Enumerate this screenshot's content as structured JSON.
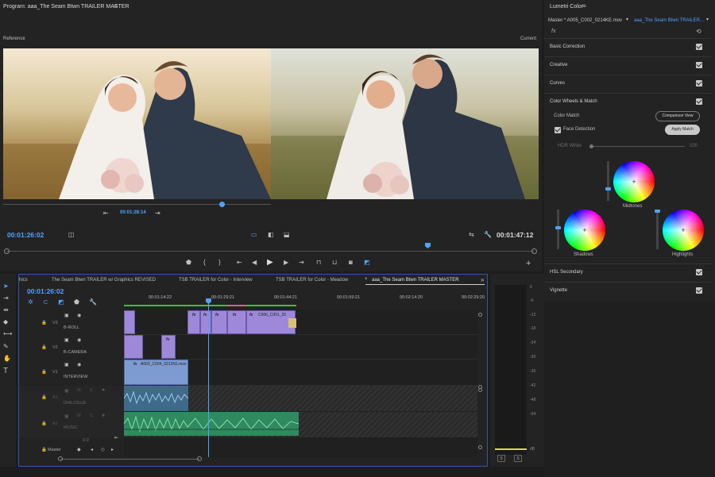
{
  "program": {
    "title": "Program: aaa_The Seam  Btwn TRAILER MASTER",
    "reference_label": "Reference",
    "current_label": "Current",
    "ref_timecode": "00:01:28:14",
    "left_timecode": "00:01:26:02",
    "right_timecode": "00:01:47:12"
  },
  "lumetri": {
    "title": "Lumetri Color",
    "master_label": "Master * A005_C002_0214KE.mov",
    "sequence_label": "aaa_The Seam  Btwn TRAILER...",
    "fx_label": "fx",
    "sections": {
      "basic": "Basic Correction",
      "creative": "Creative",
      "curves": "Curves",
      "wheels": "Color Wheels & Match",
      "hsl": "HSL Secondary",
      "vignette": "Vignette"
    },
    "color_match_label": "Color Match",
    "comparison_view": "Comparison View",
    "face_detection": "Face Detection",
    "apply_match": "Apply Match",
    "hdr_white_label": "HDR White",
    "hdr_white_value": "100",
    "hdr_white_fraction": 0.0,
    "wheels": {
      "midtones": "Midtones",
      "shadows": "Shadows",
      "highlights": "Highlights"
    }
  },
  "timeline": {
    "tabs": [
      "hics",
      "The Seam Btwn TRAILER w/ Graphics REVISED",
      "TSB TRAILER for Color - Interview",
      "TSB TRAILER for Color - Meadow",
      "aaa_The Seam  Btwn TRAILER MASTER"
    ],
    "timecode": "00:01:26:02",
    "ruler": [
      "00:01:14:22",
      "00:01:29:21",
      "00:01:44:21",
      "00:01:59:21",
      "00:02:14:20",
      "00:02:29:20"
    ],
    "tracks": [
      {
        "id": "V3",
        "name": "B-ROLL"
      },
      {
        "id": "V2",
        "name": "B-CAMERA"
      },
      {
        "id": "V1",
        "name": "INTERVIEW"
      },
      {
        "id": "A1",
        "name": "DIALOGUE"
      },
      {
        "id": "A2",
        "name": "MUSIC"
      }
    ],
    "master_label": "Master",
    "master_value": "0.0",
    "clip_v3": "C006_C001_20",
    "clip_v1": "A003_C004_0213N1.mov",
    "fx": "fx",
    "track_toggles": {
      "m": "M",
      "s": "S"
    }
  },
  "meter": {
    "ticks": [
      "0",
      "-6",
      "-12",
      "-18",
      "-24",
      "-30",
      "-36",
      "-42",
      "-48",
      "-54",
      "dB"
    ],
    "solo": "S"
  },
  "colors": {
    "accent": "#4ea3ff",
    "clip_video": "#9d89d8",
    "clip_interview": "#7d9bd0",
    "clip_audio": "#2f8a5f"
  }
}
